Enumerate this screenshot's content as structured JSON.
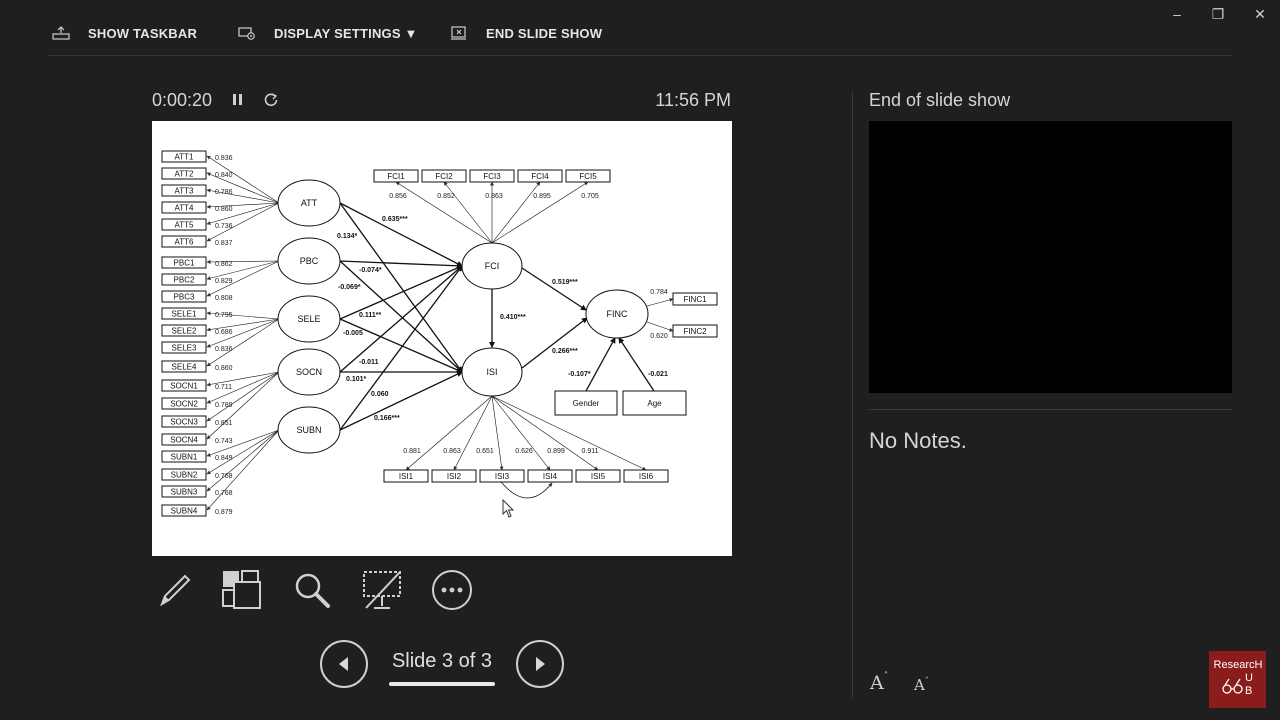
{
  "toolbar": {
    "show_taskbar": "SHOW TASKBAR",
    "display_settings": "DISPLAY SETTINGS ▼",
    "end_slide_show": "END SLIDE SHOW"
  },
  "window": {
    "minimize": "–",
    "restore": "❐",
    "close": "✕"
  },
  "timer": {
    "elapsed": "0:00:20",
    "clock": "11:56 PM"
  },
  "navigation": {
    "slide_label": "Slide 3 of 3"
  },
  "next_panel": {
    "title": "End of slide show"
  },
  "notes": {
    "text": "No Notes."
  },
  "font_controls": {
    "increase": "A",
    "decrease": "A"
  },
  "logo": {
    "line1": "ResearcH",
    "line2": "U",
    "line3": "B"
  },
  "diagram": {
    "left_indicators": [
      {
        "label": "ATT1",
        "loading": "0.836"
      },
      {
        "label": "ATT2",
        "loading": "0.840"
      },
      {
        "label": "ATT3",
        "loading": "0.786"
      },
      {
        "label": "ATT4",
        "loading": "0.860"
      },
      {
        "label": "ATT5",
        "loading": "0.736"
      },
      {
        "label": "ATT6",
        "loading": "0.837"
      },
      {
        "label": "PBC1",
        "loading": "0.862"
      },
      {
        "label": "PBC2",
        "loading": "0.829"
      },
      {
        "label": "PBC3",
        "loading": "0.808"
      },
      {
        "label": "SELE1",
        "loading": "0.795"
      },
      {
        "label": "SELE2",
        "loading": "0.686"
      },
      {
        "label": "SELE3",
        "loading": "0.836"
      },
      {
        "label": "SELE4",
        "loading": "0.860"
      },
      {
        "label": "SOCN1",
        "loading": "0.711"
      },
      {
        "label": "SOCN2",
        "loading": "0.789"
      },
      {
        "label": "SOCN3",
        "loading": "0.851"
      },
      {
        "label": "SOCN4",
        "loading": "0.743"
      },
      {
        "label": "SUBN1",
        "loading": "0.849"
      },
      {
        "label": "SUBN2",
        "loading": "0.768"
      },
      {
        "label": "SUBN3",
        "loading": "0.768"
      },
      {
        "label": "SUBN4",
        "loading": "0.879"
      }
    ],
    "left_constructs": [
      "ATT",
      "PBC",
      "SELE",
      "SOCN",
      "SUBN"
    ],
    "mediators": [
      "FCI",
      "ISI"
    ],
    "outcome": "FINC",
    "controls": [
      "Gender",
      "Age"
    ],
    "fci_items": [
      {
        "label": "FCI1",
        "loading": "0.856"
      },
      {
        "label": "FCI2",
        "loading": "0.852"
      },
      {
        "label": "FCI3",
        "loading": "0.863"
      },
      {
        "label": "FCI4",
        "loading": "0.895"
      },
      {
        "label": "FCI5",
        "loading": "0.705"
      }
    ],
    "isi_items": [
      {
        "label": "ISI1",
        "loading": "0.881"
      },
      {
        "label": "ISI2",
        "loading": "0.863"
      },
      {
        "label": "ISI3",
        "loading": "0.651"
      },
      {
        "label": "ISI4",
        "loading": "0.626"
      },
      {
        "label": "ISI5",
        "loading": "0.899"
      },
      {
        "label": "ISI6",
        "loading": "0.911"
      }
    ],
    "finc_items": [
      {
        "label": "FINC1",
        "loading": "0.784"
      },
      {
        "label": "FINC2",
        "loading": "0.620"
      }
    ],
    "paths": {
      "att_fci": "0.635***",
      "att_isi": "0.134*",
      "pbc_fci": "-0.074*",
      "pbc_isi": "-0.069*",
      "sele_fci": "0.111**",
      "sele_isi": "-0.005",
      "socn_fci": "-0.011",
      "socn_isi": "0.101*",
      "subn_fci": "0.060",
      "subn_isi": "0.166***",
      "fci_isi": "0.410***",
      "fci_finc": "0.519***",
      "isi_finc": "0.266***",
      "gender_finc": "-0.107*",
      "age_finc": "-0.021"
    }
  }
}
